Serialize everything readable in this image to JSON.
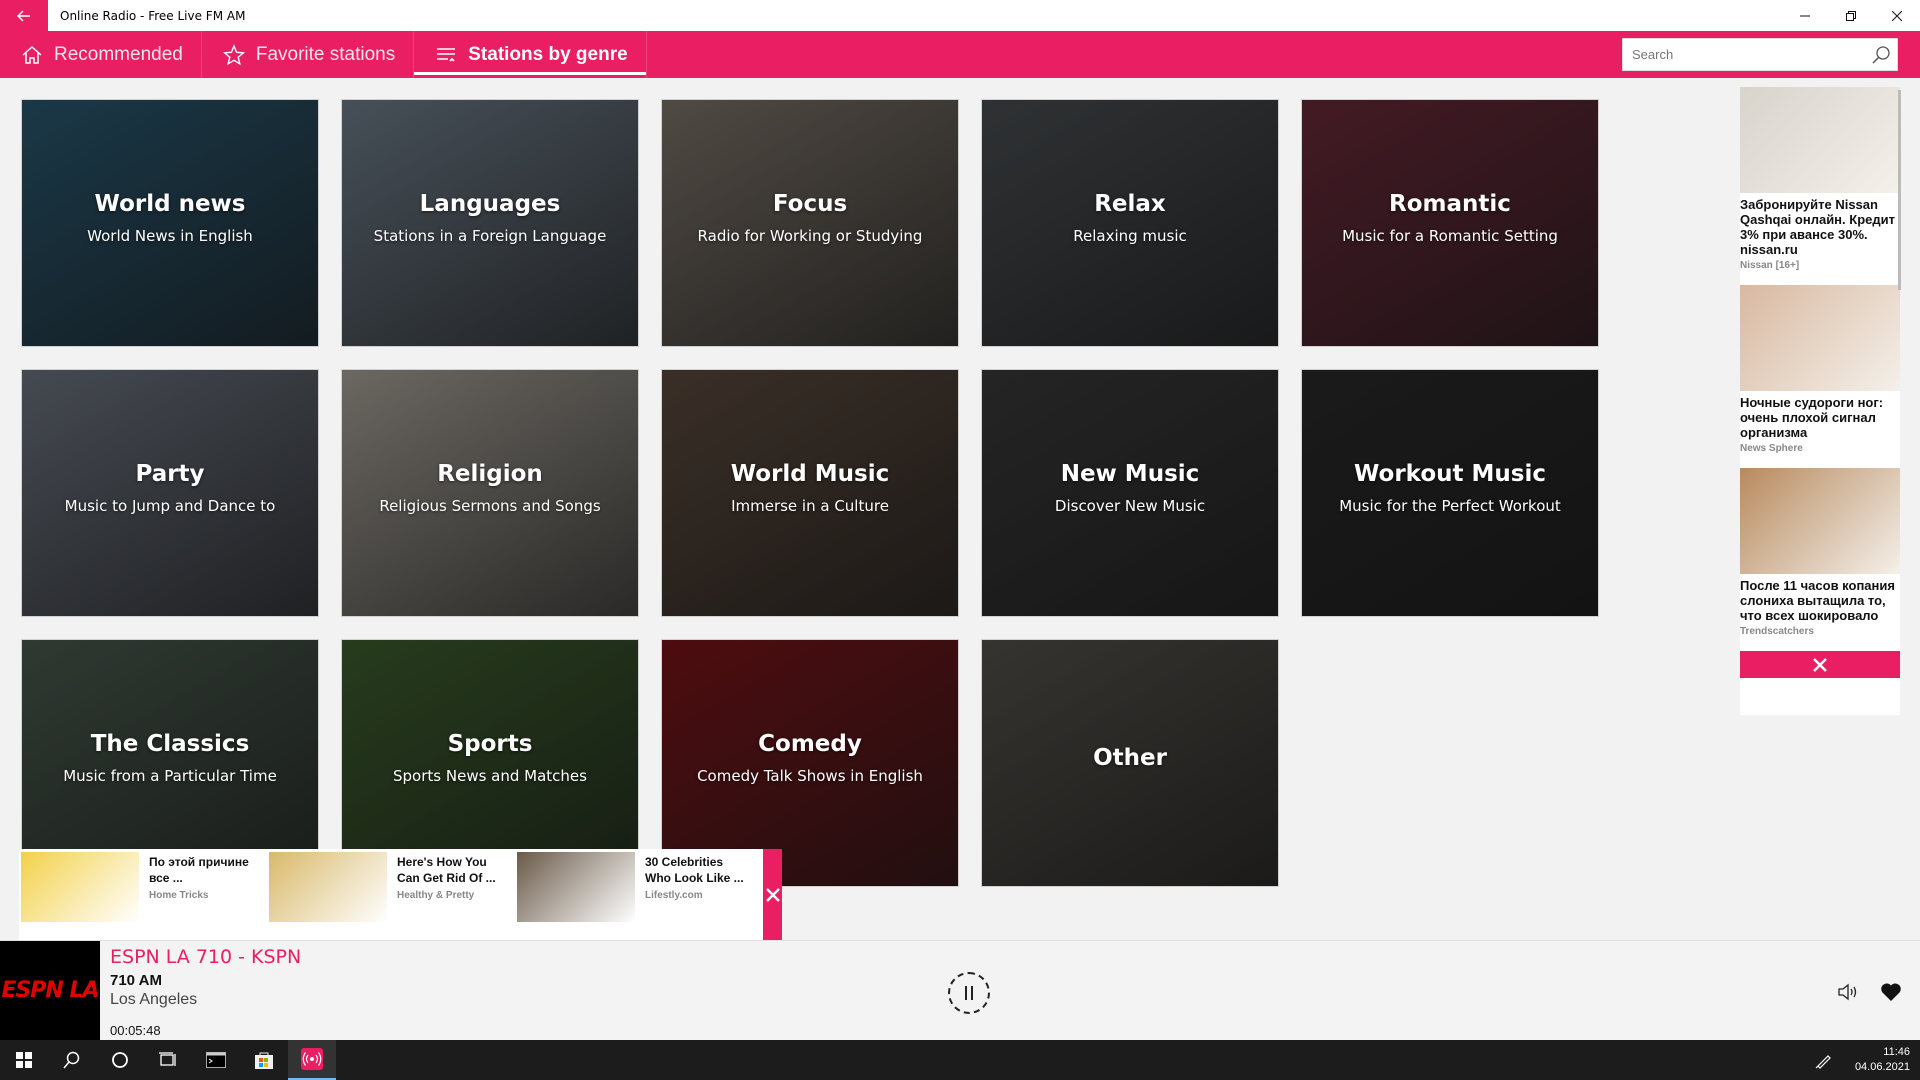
{
  "window": {
    "title": "Online Radio - Free Live FM AM"
  },
  "nav": {
    "tabs": [
      {
        "label": "Recommended",
        "icon": "home-icon",
        "active": false
      },
      {
        "label": "Favorite stations",
        "icon": "star-icon",
        "active": false
      },
      {
        "label": "Stations by genre",
        "icon": "genre-list-icon",
        "active": true
      }
    ],
    "search_placeholder": "Search"
  },
  "genres": [
    {
      "title": "World news",
      "subtitle": "World News in English",
      "color": "#2a5870"
    },
    {
      "title": "Languages",
      "subtitle": "Stations in a Foreign Language",
      "color": "#6f7d8a"
    },
    {
      "title": "Focus",
      "subtitle": "Radio for Working or Studying",
      "color": "#7d746a"
    },
    {
      "title": "Relax",
      "subtitle": "Relaxing music",
      "color": "#4a4e52"
    },
    {
      "title": "Romantic",
      "subtitle": "Music for a Romantic Setting",
      "color": "#6b2a3a"
    },
    {
      "title": "Party",
      "subtitle": "Music to Jump and Dance to",
      "color": "#6d7480"
    },
    {
      "title": "Religion",
      "subtitle": "Religious Sermons and Songs",
      "color": "#a8a299"
    },
    {
      "title": "World Music",
      "subtitle": "Immerse in a Culture",
      "color": "#5b4a3e"
    },
    {
      "title": "New Music",
      "subtitle": "Discover New Music",
      "color": "#3a3a3a"
    },
    {
      "title": "Workout Music",
      "subtitle": "Music for the Perfect Workout",
      "color": "#2a2a2a"
    },
    {
      "title": "The Classics",
      "subtitle": "Music from a Particular Time",
      "color": "#4a5a4e"
    },
    {
      "title": "Sports",
      "subtitle": "Sports News and Matches",
      "color": "#3d5e2e"
    },
    {
      "title": "Comedy",
      "subtitle": "Comedy Talk Shows in English",
      "color": "#7a1418"
    },
    {
      "title": "Other",
      "subtitle": "",
      "color": "#55524c"
    }
  ],
  "right_ads": [
    {
      "text": "Забронируйте Nissan Qashqai онлайн. Кредит 3% при авансе 30%. nissan.ru",
      "source": "Nissan [16+]",
      "color": "#d8d4cc"
    },
    {
      "text": "Ночные судороги ног: очень плохой сигнал организма",
      "source": "News Sphere",
      "color": "#d9b8a0"
    },
    {
      "text": "После 11 часов копания слониха вытащила то, что всех шокировало",
      "source": "Trendscatchers",
      "color": "#b88a5e"
    }
  ],
  "bottom_ads": [
    {
      "line1": "По этой причине",
      "line2": "все ...",
      "source": "Home Tricks",
      "color": "#f2d14a"
    },
    {
      "line1": "Here's How You",
      "line2": "Can Get Rid Of ...",
      "source": "Healthy & Pretty",
      "color": "#d9b96a"
    },
    {
      "line1": "30 Celebrities",
      "line2": "Who Look Like ...",
      "source": "Lifestly.com",
      "color": "#6a5a48"
    }
  ],
  "player": {
    "station_name": "ESPN LA 710 - KSPN",
    "frequency": "710 AM",
    "city": "Los Angeles",
    "elapsed": "00:05:48",
    "logo_text": "ESPN LA",
    "state": "playing"
  },
  "taskbar": {
    "time": "11:46",
    "date": "04.06.2021"
  },
  "colors": {
    "accent": "#e91e63"
  }
}
